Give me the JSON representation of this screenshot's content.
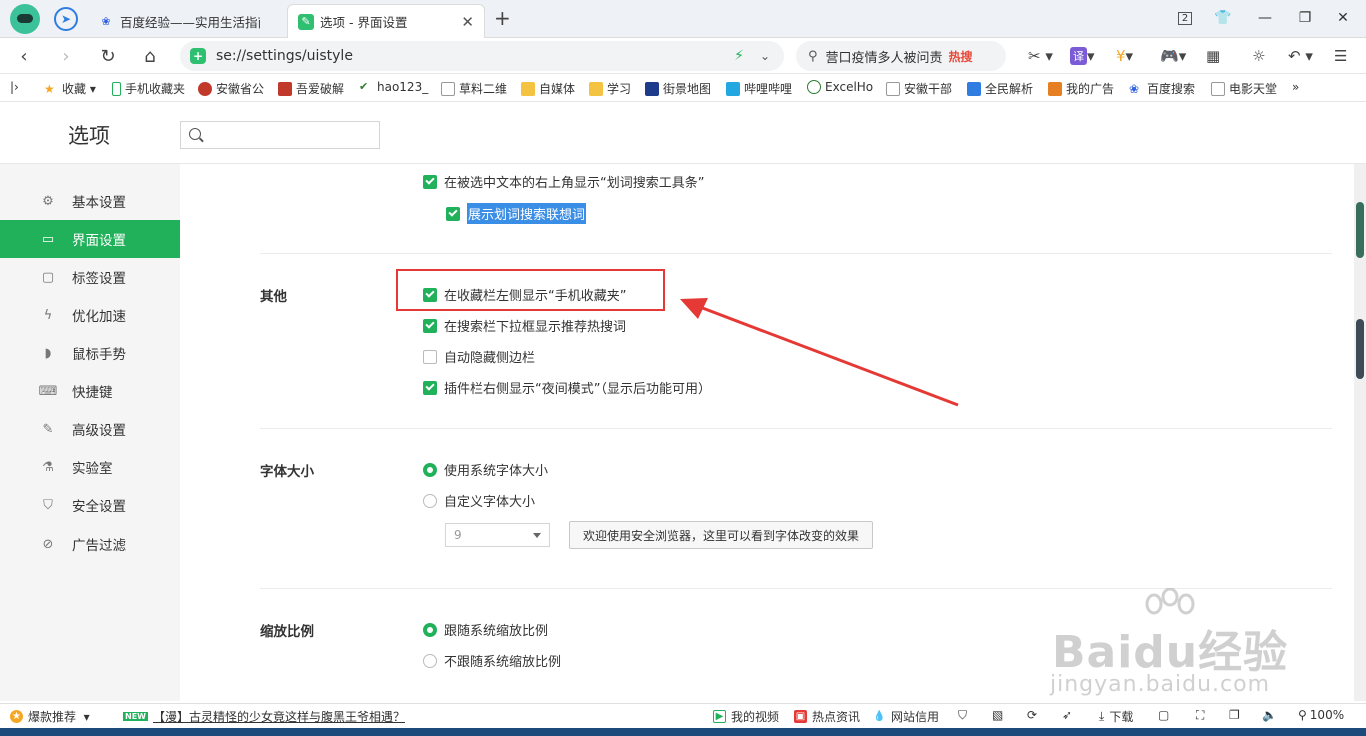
{
  "tabs": [
    {
      "title": "百度经验——实用生活指南",
      "active": false
    },
    {
      "title": "选项 - 界面设置",
      "active": true
    }
  ],
  "window": {
    "tab_count": "2"
  },
  "address": {
    "url": "se://settings/uistyle"
  },
  "search": {
    "text": "营口疫情多人被问责",
    "hot_label": "热搜"
  },
  "bookmarks": [
    {
      "label": "收藏",
      "color": "#f5a623"
    },
    {
      "label": "手机收藏夹",
      "color": "#20b15a"
    },
    {
      "label": "安徽省公",
      "color": "#c0392b"
    },
    {
      "label": "吾爱破解",
      "color": "#c0392b"
    },
    {
      "label": "hao123_",
      "color": "#2e7d32"
    },
    {
      "label": "草料二维",
      "color": "#999999"
    },
    {
      "label": "自媒体",
      "color": "#f5c342"
    },
    {
      "label": "学习",
      "color": "#f5c342"
    },
    {
      "label": "街景地图",
      "color": "#1e3a8a"
    },
    {
      "label": "哔哩哔哩",
      "color": "#23a7e0"
    },
    {
      "label": "ExcelHo",
      "color": "#2e7d32"
    },
    {
      "label": "安徽干部",
      "color": "#999999"
    },
    {
      "label": "全民解析",
      "color": "#2f7de1"
    },
    {
      "label": "我的广告",
      "color": "#e67e22"
    },
    {
      "label": "百度搜索",
      "color": "#2f5fe1"
    },
    {
      "label": "电影天堂",
      "color": "#999999"
    }
  ],
  "settings": {
    "title": "选项",
    "search_placeholder": ""
  },
  "sidebar": [
    {
      "label": "基本设置",
      "icon": "gear-icon",
      "active": false
    },
    {
      "label": "界面设置",
      "icon": "window-icon",
      "active": true
    },
    {
      "label": "标签设置",
      "icon": "tab-icon",
      "active": false
    },
    {
      "label": "优化加速",
      "icon": "lightning-icon",
      "active": false
    },
    {
      "label": "鼠标手势",
      "icon": "mouse-icon",
      "active": false
    },
    {
      "label": "快捷键",
      "icon": "keyboard-icon",
      "active": false
    },
    {
      "label": "高级设置",
      "icon": "wrench-icon",
      "active": false
    },
    {
      "label": "实验室",
      "icon": "flask-icon",
      "active": false
    },
    {
      "label": "安全设置",
      "icon": "shield-icon",
      "active": false
    },
    {
      "label": "广告过滤",
      "icon": "block-icon",
      "active": false
    }
  ],
  "content": {
    "top_options": [
      {
        "label": "在被选中文本的右上角显示“划词搜索工具条”",
        "checked": true
      },
      {
        "label": "展示划词搜索联想词",
        "checked": true,
        "selected": true
      }
    ],
    "other": {
      "label": "其他",
      "options": [
        {
          "label": "在收藏栏左侧显示“手机收藏夹”",
          "checked": true
        },
        {
          "label": "在搜索栏下拉框显示推荐热搜词",
          "checked": true
        },
        {
          "label": "自动隐藏侧边栏",
          "checked": false
        },
        {
          "label": "插件栏右侧显示“夜间模式”（显示后功能可用）",
          "checked": true
        }
      ]
    },
    "font_size": {
      "label": "字体大小",
      "options": [
        {
          "label": "使用系统字体大小",
          "selected": true
        },
        {
          "label": "自定义字体大小",
          "selected": false
        }
      ],
      "size_value": "9",
      "preview_button": "欢迎使用安全浏览器，这里可以看到字体改变的效果"
    },
    "zoom": {
      "label": "缩放比例",
      "options": [
        {
          "label": "跟随系统缩放比例",
          "selected": true
        },
        {
          "label": "不跟随系统缩放比例",
          "selected": false
        }
      ]
    }
  },
  "watermark": {
    "big": "Baidu经验",
    "small": "jingyan.baidu.com"
  },
  "status": {
    "recommend": "爆款推荐",
    "news_badge": "NEW",
    "news": "【漫】古灵精怪的少女竟这样与腹黑王爷相遇？",
    "video": "我的视频",
    "hot": "热点资讯",
    "credit": "网站信用",
    "download": "下载",
    "zoom": "100%"
  }
}
